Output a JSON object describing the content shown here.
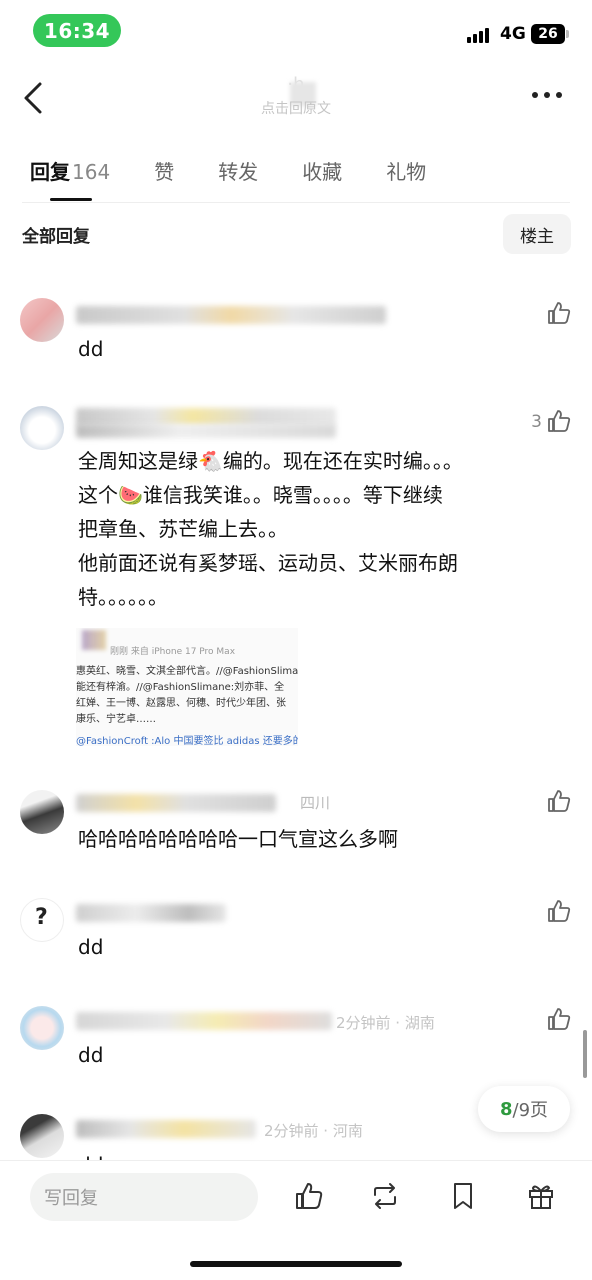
{
  "status_bar": {
    "time": "16:34",
    "network": "4G",
    "battery": "26"
  },
  "nav": {
    "title": "·h",
    "subtitle": "点击回原文"
  },
  "tabs": [
    {
      "label": "回复",
      "count": "164"
    },
    {
      "label": "赞"
    },
    {
      "label": "转发"
    },
    {
      "label": "收藏"
    },
    {
      "label": "礼物"
    }
  ],
  "filter": {
    "label": "全部回复",
    "owner_button": "楼主"
  },
  "comments": [
    {
      "text": "dd",
      "likes": ""
    },
    {
      "text_lines": [
        "全周知这是绿🐔编的。现在还在实时编。。。",
        "这个🍉谁信我笑谁。。晓雪。。。。等下继续",
        "把章鱼、苏芒编上去。。",
        "他前面还说有奚梦瑶、运动员、艾米丽布朗",
        "特。。。。。。"
      ],
      "likes": "3",
      "screenshot": {
        "header": "刚刚  来自 iPhone 17 Pro Max",
        "lines": [
          "惠英红、晓雪、文淇全部代言。//@FashionSliman",
          "能还有梓渝。//@FashionSlimane:刘亦菲、全",
          "红婵、王一博、赵露思、何穗、时代少年团、张",
          "康乐、宁艺卓……",
          "@FashionCroft :Alo 中国要签比 adidas 还要多的代言"
        ]
      }
    },
    {
      "meta_suffix": "四川",
      "text": "哈哈哈哈哈哈哈哈一口气宣这么多啊",
      "likes": ""
    },
    {
      "text": "dd",
      "likes": ""
    },
    {
      "meta_suffix": "2分钟前 · 湖南",
      "text": "dd",
      "likes": ""
    },
    {
      "meta_suffix": "2分钟前 · 河南",
      "text": "dd",
      "likes": ""
    }
  ],
  "page_indicator": {
    "current": "8",
    "total": "/9页"
  },
  "bottom_bar": {
    "reply_placeholder": "写回复"
  },
  "colors": {
    "accent_green": "#2e9a3e",
    "status_pill": "#34c759"
  }
}
